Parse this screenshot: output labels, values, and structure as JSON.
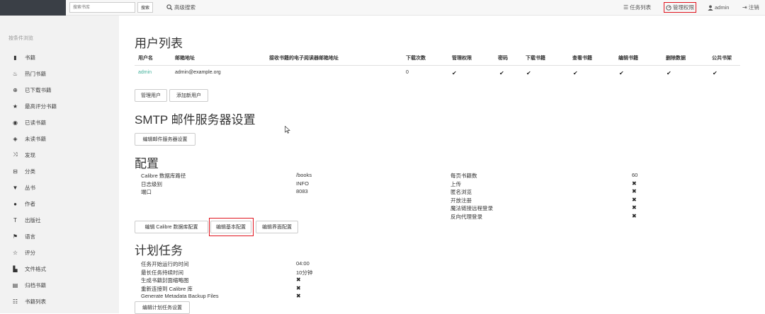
{
  "topbar": {
    "search_placeholder": "搜索书库",
    "search_button": "搜索",
    "advanced_search": "高级搜索",
    "tasks": "任务列表",
    "admin_panel": "管理权限",
    "user": "admin",
    "logout": "注销"
  },
  "sidebar": {
    "title": "按条件浏览",
    "items": [
      {
        "icon": "book-icon",
        "label": "书籍"
      },
      {
        "icon": "fire-icon",
        "label": "热门书籍"
      },
      {
        "icon": "download-icon",
        "label": "已下载书籍"
      },
      {
        "icon": "star-icon",
        "label": "最高评分书籍"
      },
      {
        "icon": "eye-icon",
        "label": "已读书籍"
      },
      {
        "icon": "eye-slash-icon",
        "label": "未读书籍"
      },
      {
        "icon": "random-icon",
        "label": "发现"
      },
      {
        "icon": "inbox-icon",
        "label": "分类"
      },
      {
        "icon": "bookmark-icon",
        "label": "丛书"
      },
      {
        "icon": "user-icon",
        "label": "作者"
      },
      {
        "icon": "text-size-icon",
        "label": "出版社"
      },
      {
        "icon": "flag-icon",
        "label": "语言"
      },
      {
        "icon": "star-empty-icon",
        "label": "评分"
      },
      {
        "icon": "file-icon",
        "label": "文件格式"
      },
      {
        "icon": "archive-icon",
        "label": "归档书籍"
      },
      {
        "icon": "list-icon",
        "label": "书籍列表"
      }
    ]
  },
  "users": {
    "title": "用户列表",
    "headers": [
      "用户名",
      "邮箱地址",
      "接收书籍的电子阅读器邮箱地址",
      "下载次数",
      "管理权限",
      "密码",
      "下载书籍",
      "查看书籍",
      "编辑书籍",
      "删除数据",
      "公共书架"
    ],
    "row": {
      "username": "admin",
      "email": "admin@example.org",
      "ereader": "",
      "downloads": "0",
      "checks": [
        "✔",
        "✔",
        "✔",
        "✔",
        "✔",
        "✔",
        "✔"
      ]
    },
    "btn_manage": "管理用户",
    "btn_add": "添加新用户"
  },
  "smtp": {
    "title": "SMTP 邮件服务器设置",
    "btn_edit": "编辑邮件服务器设置"
  },
  "config": {
    "title": "配置",
    "left": [
      {
        "k": "Calibre 数据库路径",
        "v": "/books"
      },
      {
        "k": "日志级别",
        "v": "INFO"
      },
      {
        "k": "端口",
        "v": "8083"
      }
    ],
    "right": [
      {
        "k": "每页书籍数",
        "v": "60"
      },
      {
        "k": "上传",
        "v": "✖"
      },
      {
        "k": "匿名浏览",
        "v": "✖"
      },
      {
        "k": "开放注册",
        "v": "✖"
      },
      {
        "k": "魔法链接远程登录",
        "v": "✖"
      },
      {
        "k": "反向代理登录",
        "v": "✖"
      }
    ],
    "btn_db": "编辑 Calibre 数据库配置",
    "btn_basic": "编辑基本配置",
    "btn_ui": "编辑界面配置"
  },
  "schedule": {
    "title": "计划任务",
    "rows": [
      {
        "k": "任务开始运行的时间",
        "v": "04:00"
      },
      {
        "k": "最长任务持续时间",
        "v": "10分钟"
      },
      {
        "k": "生成书籍封面缩略图",
        "v": "✖"
      },
      {
        "k": "重新连接到 Calibre 库",
        "v": "✖"
      },
      {
        "k": "Generate Metadata Backup Files",
        "v": "✖"
      }
    ],
    "btn_edit": "编辑计划任务设置"
  }
}
